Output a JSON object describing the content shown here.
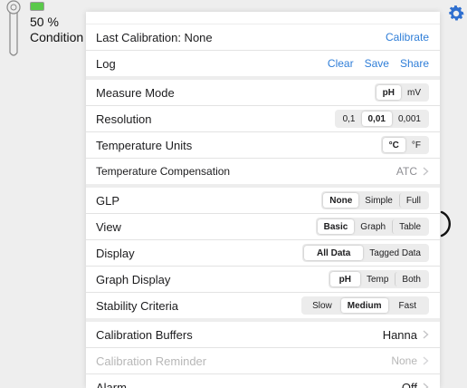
{
  "background": {
    "battery_percent": "50 %",
    "status_text": "Condition -",
    "accent_color": "#2f6fcf"
  },
  "panel": {
    "rows": [
      {
        "label": "Last Calibration:  None",
        "action": "Calibrate"
      },
      {
        "label": "Log",
        "links": [
          "Clear",
          "Save",
          "Share"
        ]
      }
    ],
    "measure_mode": {
      "label": "Measure Mode",
      "options": [
        "pH",
        "mV"
      ],
      "selected": "pH"
    },
    "resolution": {
      "label": "Resolution",
      "options": [
        "0,1",
        "0,01",
        "0,001"
      ],
      "selected": "0,01"
    },
    "temperature_units": {
      "label": "Temperature Units",
      "options": [
        "°C",
        "°F"
      ],
      "selected": "°C"
    },
    "temperature_compensation": {
      "label": "Temperature Compensation",
      "value": "ATC"
    },
    "glp": {
      "label": "GLP",
      "options": [
        "None",
        "Simple",
        "Full"
      ],
      "selected": "None"
    },
    "view": {
      "label": "View",
      "options": [
        "Basic",
        "Graph",
        "Table"
      ],
      "selected": "Basic"
    },
    "display": {
      "label": "Display",
      "options": [
        "All Data",
        "Tagged Data"
      ],
      "selected": "All Data"
    },
    "graph_display": {
      "label": "Graph Display",
      "options": [
        "pH",
        "Temp",
        "Both"
      ],
      "selected": "pH"
    },
    "stability_criteria": {
      "label": "Stability Criteria",
      "options": [
        "Slow",
        "Medium",
        "Fast"
      ],
      "selected": "Medium"
    },
    "calibration_buffers": {
      "label": "Calibration Buffers",
      "value": "Hanna"
    },
    "calibration_reminder": {
      "label": "Calibration Reminder",
      "value": "None"
    },
    "alarm": {
      "label": "Alarm",
      "value": "Off"
    }
  },
  "colors": {
    "link": "#2f7ed8",
    "gear": "#2f6fcf",
    "battery": "#5ac94a"
  }
}
